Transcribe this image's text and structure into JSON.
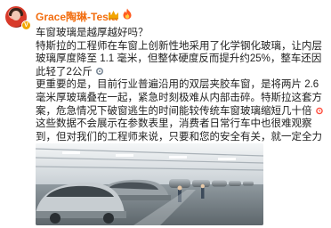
{
  "post": {
    "author_name": "Grace陶琳-Tesla",
    "verified_badge": "V",
    "author_icons": [
      "crown-icon",
      "fire-icon"
    ],
    "paragraphs": [
      "车窗玻璃是越厚越好吗？",
      "特斯拉的工程师在车窗上创新性地采用了化学钢化玻璃，让内层玻璃厚度降至 1.1 毫米，但整体硬度反而提升约25%，整车还因此轻了2公斤",
      "更重要的是，目前行业普遍沿用的双层夹胶车窗，是将两片 2.6 毫米厚玻璃叠在一起，紧急时刻极难从内部击碎。特斯拉这套方案，危急情况下破窗逃生的时间能较传统车窗玻璃缩短几十倍",
      "这些数据不会展示在参数表里，消费者日常行车中也很难观察到，但对我们的工程师来说，只要和您的安全有关，就一定全力以赴"
    ],
    "inline_emojis": [
      "gear-icon",
      "alarm-icon",
      "strong-arm-icon"
    ],
    "image_description_name": "factory-assembly-line-photo"
  },
  "colors": {
    "name": "#f26d0f",
    "text": "#222222",
    "badge": "#f2a500"
  }
}
